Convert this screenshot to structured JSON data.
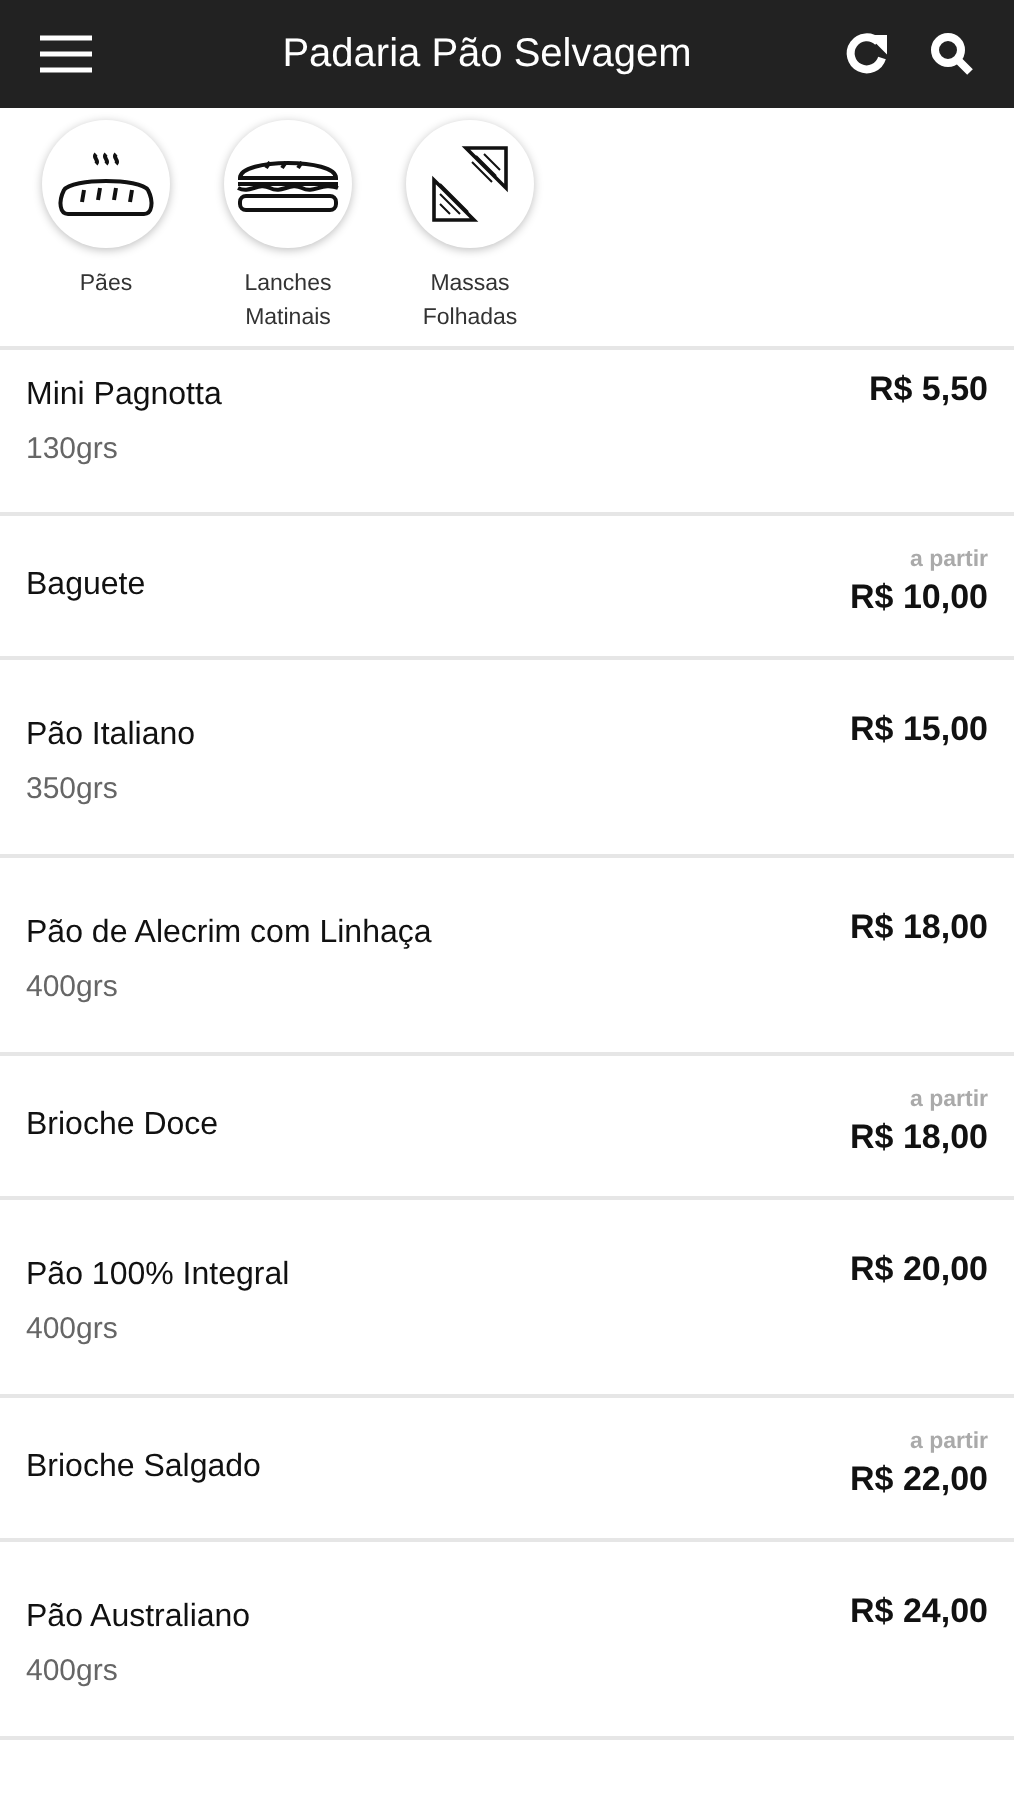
{
  "header": {
    "title": "Padaria Pão Selvagem"
  },
  "categories": [
    {
      "kind": "bread",
      "label": "Pães"
    },
    {
      "kind": "sandwich",
      "label": "Lanches Matinais"
    },
    {
      "kind": "pastry",
      "label": "Massas Folhadas"
    }
  ],
  "products": [
    {
      "name": "Mini Pagnotta",
      "weight": "130grs",
      "price": "R$ 5,50"
    },
    {
      "name": "Baguete",
      "price_note": "a partir",
      "price": "R$ 10,00"
    },
    {
      "name": "Pão Italiano",
      "weight": "350grs",
      "price": "R$ 15,00"
    },
    {
      "name": "Pão de Alecrim com Linhaça",
      "weight": "400grs",
      "price": "R$ 18,00"
    },
    {
      "name": "Brioche Doce",
      "price_note": "a partir",
      "price": "R$ 18,00"
    },
    {
      "name": "Pão 100% Integral",
      "weight": "400grs",
      "price": "R$ 20,00"
    },
    {
      "name": "Brioche Salgado",
      "price_note": "a partir",
      "price": "R$ 22,00"
    },
    {
      "name": "Pão Australiano",
      "weight": "400grs",
      "price": "R$ 24,00"
    }
  ]
}
